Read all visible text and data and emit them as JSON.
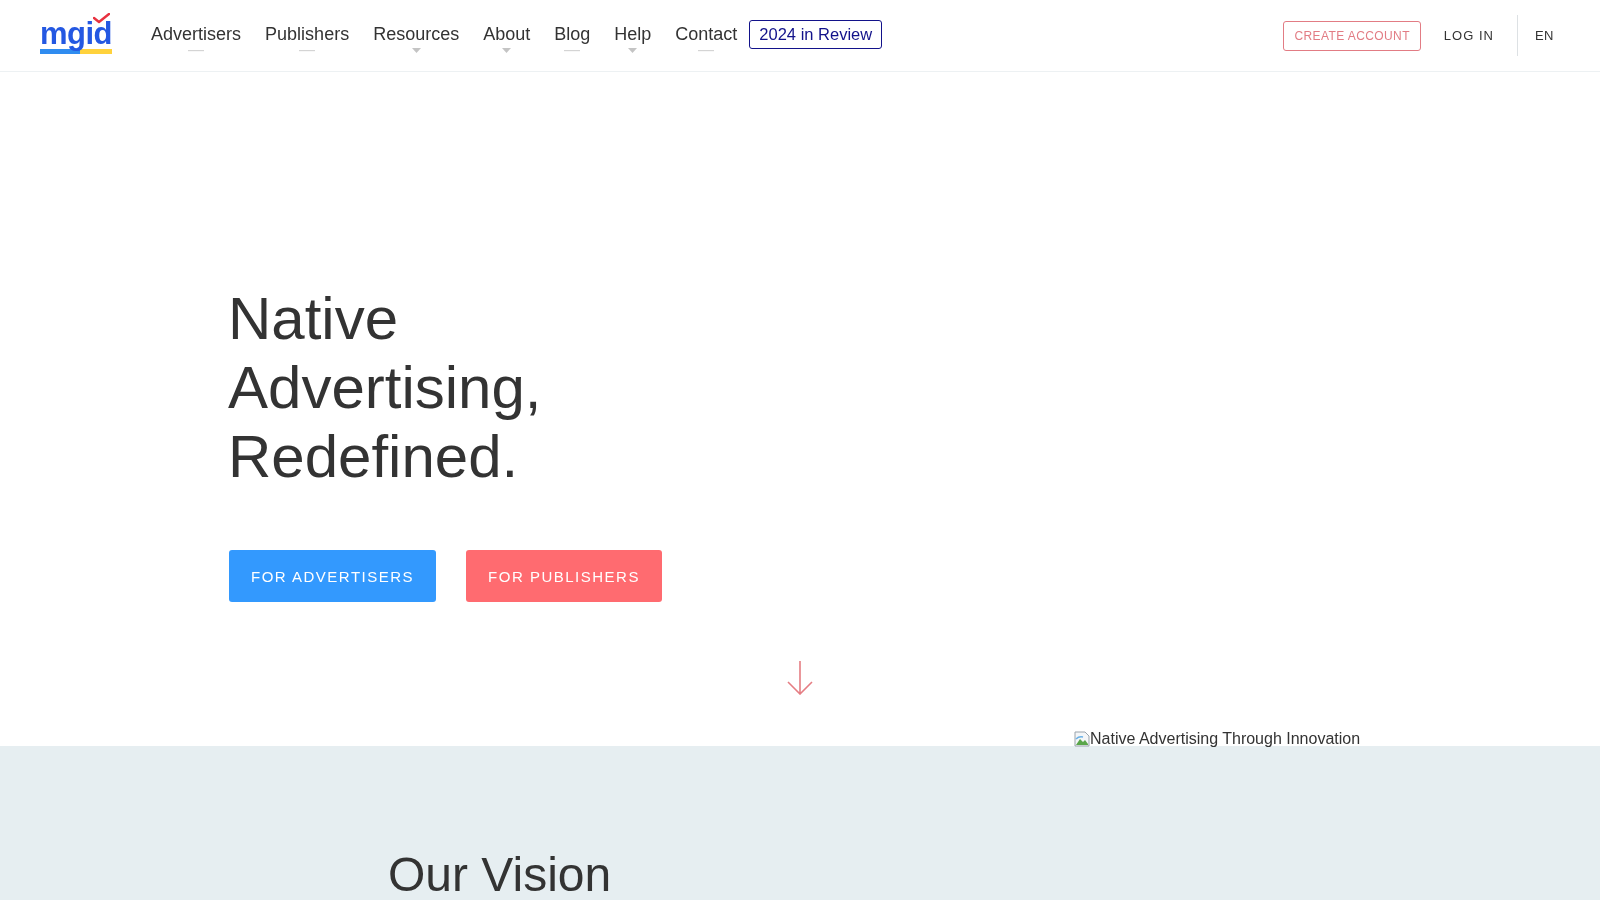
{
  "header": {
    "logo": "mgid",
    "nav": [
      {
        "label": "Advertisers",
        "kind": "link"
      },
      {
        "label": "Publishers",
        "kind": "link"
      },
      {
        "label": "Resources",
        "kind": "dropdown"
      },
      {
        "label": "About",
        "kind": "dropdown"
      },
      {
        "label": "Blog",
        "kind": "link"
      },
      {
        "label": "Help",
        "kind": "dropdown"
      },
      {
        "label": "Contact",
        "kind": "link"
      }
    ],
    "highlight_link": "2024 in Review",
    "create_account": "CREATE ACCOUNT",
    "log_in": "LOG IN",
    "language": "EN"
  },
  "hero": {
    "headline": "Native Advertising, Redefined.",
    "buttons": [
      {
        "label": "FOR ADVERTISERS",
        "kind": "primary"
      },
      {
        "label": "FOR PUBLISHERS",
        "kind": "secondary"
      }
    ],
    "image_alt": "Native Advertising Through Innovation"
  },
  "vision": {
    "title": "Our Vision"
  }
}
